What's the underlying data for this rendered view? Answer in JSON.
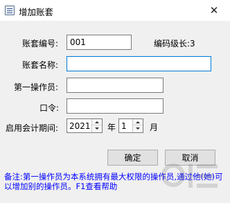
{
  "window": {
    "title": "增加账套",
    "close_glyph": "✕"
  },
  "form": {
    "code_label": "账套编号:",
    "code_value": "001",
    "level_label": "编码级长:3",
    "name_label": "账套名称:",
    "name_value": "",
    "operator_label": "第一操作员:",
    "operator_value": "",
    "password_label": "口令:",
    "password_value": "",
    "period_label": "启用会计期间:",
    "year_value": "2021",
    "year_unit": "年",
    "month_value": "1",
    "month_unit": "月"
  },
  "buttons": {
    "ok": "确定",
    "cancel": "取消"
  },
  "note": "备注:第一操作员为本系统拥有最大权限的操作员,通过他(她)可以增加别的操作员。F1查看帮助",
  "colors": {
    "note": "#0000ff",
    "focus_border": "#0078d7"
  },
  "icons": {
    "app": "ledger-icon",
    "close": "close-icon"
  }
}
